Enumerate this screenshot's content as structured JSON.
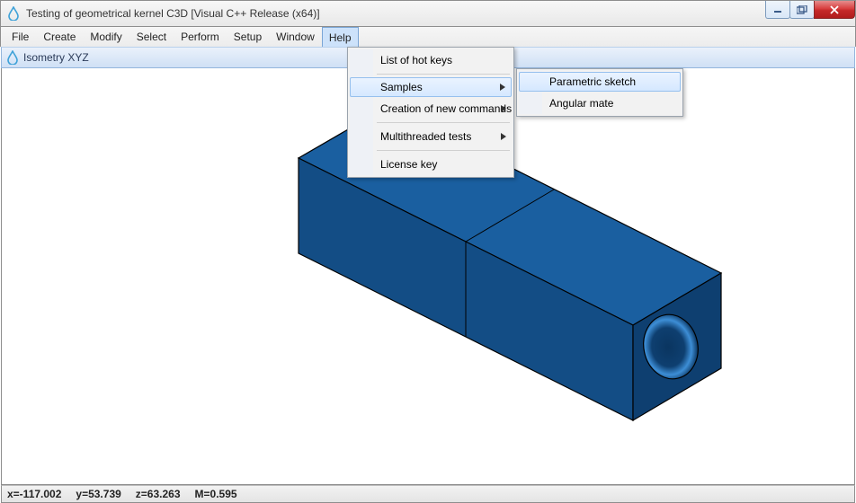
{
  "window": {
    "title": "Testing of geometrical kernel C3D [Visual C++ Release (x64)]"
  },
  "menubar": {
    "items": [
      "File",
      "Create",
      "Modify",
      "Select",
      "Perform",
      "Setup",
      "Window",
      "Help"
    ],
    "active_index": 7
  },
  "viewheader": {
    "label": "Isometry XYZ"
  },
  "help_menu": {
    "items": [
      {
        "label": "List of hot keys",
        "submenu": false
      },
      {
        "sep": true
      },
      {
        "label": "Samples",
        "submenu": true,
        "hover": true
      },
      {
        "label": "Creation of new commands",
        "submenu": true
      },
      {
        "sep": true
      },
      {
        "label": "Multithreaded tests",
        "submenu": true
      },
      {
        "sep": true
      },
      {
        "label": "License key",
        "submenu": false
      }
    ]
  },
  "samples_menu": {
    "items": [
      {
        "label": "Parametric sketch",
        "hover": true
      },
      {
        "label": "Angular mate"
      }
    ]
  },
  "statusbar": {
    "x": "x=-117.002",
    "y": "y=53.739",
    "z": "z=63.263",
    "m": "M=0.595"
  },
  "colors": {
    "block_top": "#1a5fa0",
    "block_side": "#134d85",
    "block_front": "#0e3f70",
    "hole_dark": "#0a3560",
    "hole_light": "#3d8ed6"
  }
}
